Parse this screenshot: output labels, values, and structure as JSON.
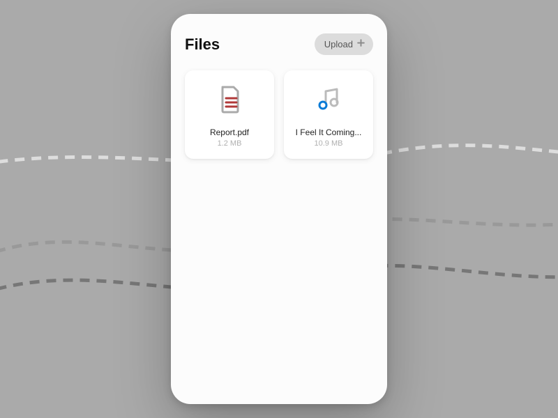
{
  "header": {
    "title": "Files",
    "upload_label": "Upload"
  },
  "files": [
    {
      "name": "Report.pdf",
      "size": "1.2 MB",
      "icon": "document"
    },
    {
      "name": "I Feel It Coming...",
      "size": "10.9 MB",
      "icon": "music"
    }
  ]
}
